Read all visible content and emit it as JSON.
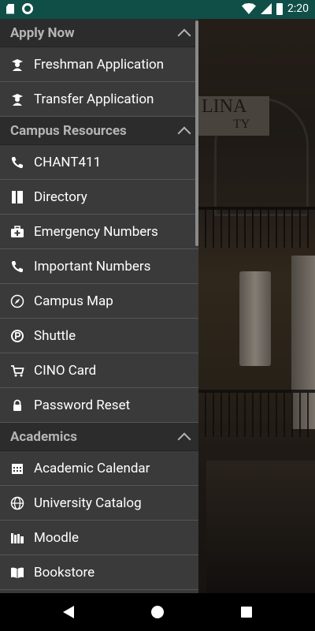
{
  "status_bar": {
    "time": "2:20"
  },
  "background": {
    "sign_line1": "LINA",
    "sign_line2": "TY"
  },
  "sections": [
    {
      "title": "Apply Now",
      "items": [
        {
          "label": "Freshman Application",
          "icon": "graduate-icon"
        },
        {
          "label": "Transfer Application",
          "icon": "graduate-icon"
        }
      ]
    },
    {
      "title": "Campus Resources",
      "items": [
        {
          "label": "CHANT411",
          "icon": "phone-icon"
        },
        {
          "label": "Directory",
          "icon": "book-icon"
        },
        {
          "label": "Emergency Numbers",
          "icon": "medkit-icon"
        },
        {
          "label": "Important Numbers",
          "icon": "phone-icon"
        },
        {
          "label": "Campus Map",
          "icon": "compass-icon"
        },
        {
          "label": "Shuttle",
          "icon": "parking-icon"
        },
        {
          "label": "CINO Card",
          "icon": "cart-icon"
        },
        {
          "label": "Password Reset",
          "icon": "lock-icon"
        }
      ]
    },
    {
      "title": "Academics",
      "items": [
        {
          "label": "Academic Calendar",
          "icon": "calendar-icon"
        },
        {
          "label": "University Catalog",
          "icon": "globe-icon"
        },
        {
          "label": "Moodle",
          "icon": "books-icon"
        },
        {
          "label": "Bookstore",
          "icon": "open-book-icon"
        }
      ]
    }
  ]
}
